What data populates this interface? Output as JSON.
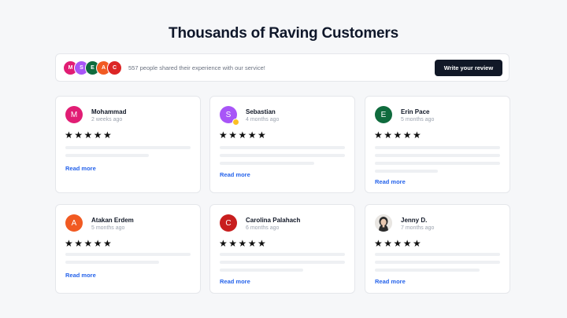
{
  "title": "Thousands of Raving Customers",
  "summary": {
    "avatars": [
      {
        "initial": "M",
        "color": "#e11d74"
      },
      {
        "initial": "S",
        "color": "#a855f7"
      },
      {
        "initial": "E",
        "color": "#0f6b3d"
      },
      {
        "initial": "A",
        "color": "#f15a22"
      },
      {
        "initial": "C",
        "color": "#dc2626"
      }
    ],
    "text": "557 people shared their experience with our service!",
    "button_label": "Write your review"
  },
  "reviews": [
    {
      "name": "Mohammad",
      "time": "2 weeks ago",
      "initial": "M",
      "color": "#e11d74",
      "stars": "★★★★★",
      "read_more": "Read more"
    },
    {
      "name": "Sebastian",
      "time": "4 months ago",
      "initial": "S",
      "color": "#a855f7",
      "stars": "★★★★★",
      "read_more": "Read more"
    },
    {
      "name": "Erin Pace",
      "time": "5 months ago",
      "initial": "E",
      "color": "#0f6b3d",
      "stars": "★★★★★",
      "read_more": "Read more"
    },
    {
      "name": "Atakan Erdem",
      "time": "5 months ago",
      "initial": "A",
      "color": "#f15a22",
      "stars": "★★★★★",
      "read_more": "Read more"
    },
    {
      "name": "Carolina Palahach",
      "time": "6 months ago",
      "initial": "C",
      "color": "#c81e1e",
      "stars": "★★★★★",
      "read_more": "Read more"
    },
    {
      "name": "Jenny D.",
      "time": "7 months ago",
      "initial": "",
      "color": "#e5e7eb",
      "stars": "★★★★★",
      "read_more": "Read more"
    }
  ]
}
